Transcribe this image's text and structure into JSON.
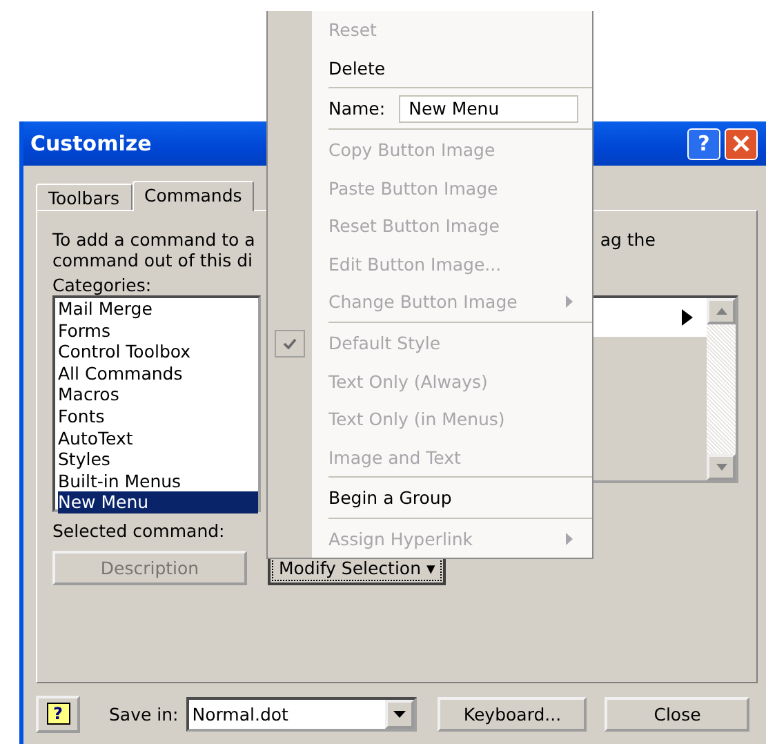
{
  "window": {
    "title": "Customize",
    "help_label": "?"
  },
  "tabs": [
    {
      "label": "Toolbars",
      "selected": false
    },
    {
      "label": "Commands",
      "selected": true
    }
  ],
  "instructions": {
    "line_1": "To add a command to a",
    "line_2": "command out of this di",
    "line_1_end": "ag the"
  },
  "categories": {
    "label": "Categories:",
    "items": [
      {
        "label": "Mail Merge",
        "selected": false
      },
      {
        "label": "Forms",
        "selected": false
      },
      {
        "label": "Control Toolbox",
        "selected": false
      },
      {
        "label": "All Commands",
        "selected": false
      },
      {
        "label": "Macros",
        "selected": false
      },
      {
        "label": "Fonts",
        "selected": false
      },
      {
        "label": "AutoText",
        "selected": false
      },
      {
        "label": "Styles",
        "selected": false
      },
      {
        "label": "Built-in Menus",
        "selected": false
      },
      {
        "label": "New Menu",
        "selected": true
      }
    ]
  },
  "commands": {
    "rows": [
      {
        "submenu": true,
        "selected": false
      }
    ]
  },
  "selected_command": {
    "label": "Selected command:",
    "description_button": {
      "label": "Description",
      "disabled": true
    },
    "modify_button": {
      "label": "Modify Selection",
      "caret": "▾"
    }
  },
  "menu": [
    {
      "kind": "command",
      "label": "Reset",
      "disabled": true,
      "checked": false,
      "submenu": false
    },
    {
      "kind": "command",
      "label": "Delete",
      "disabled": false,
      "checked": false,
      "submenu": false
    },
    {
      "kind": "separator"
    },
    {
      "kind": "field",
      "label": "Name:",
      "value": "New Menu"
    },
    {
      "kind": "separator"
    },
    {
      "kind": "command",
      "label": "Copy Button Image",
      "disabled": true,
      "checked": false,
      "submenu": false
    },
    {
      "kind": "command",
      "label": "Paste Button Image",
      "disabled": true,
      "checked": false,
      "submenu": false
    },
    {
      "kind": "command",
      "label": "Reset Button Image",
      "disabled": true,
      "checked": false,
      "submenu": false
    },
    {
      "kind": "command",
      "label": "Edit Button Image...",
      "disabled": true,
      "checked": false,
      "submenu": false
    },
    {
      "kind": "command",
      "label": "Change Button Image",
      "disabled": true,
      "checked": false,
      "submenu": true
    },
    {
      "kind": "separator"
    },
    {
      "kind": "command",
      "label": "Default Style",
      "disabled": true,
      "checked": true,
      "submenu": false
    },
    {
      "kind": "command",
      "label": "Text Only (Always)",
      "disabled": true,
      "checked": false,
      "submenu": false
    },
    {
      "kind": "command",
      "label": "Text Only (in Menus)",
      "disabled": true,
      "checked": false,
      "submenu": false
    },
    {
      "kind": "command",
      "label": "Image and Text",
      "disabled": true,
      "checked": false,
      "submenu": false
    },
    {
      "kind": "separator"
    },
    {
      "kind": "command",
      "label": "Begin a Group",
      "disabled": false,
      "checked": false,
      "submenu": false
    },
    {
      "kind": "separator"
    },
    {
      "kind": "command",
      "label": "Assign Hyperlink",
      "disabled": true,
      "checked": false,
      "submenu": true
    }
  ],
  "footer": {
    "help_label": "?",
    "save_in_label": "Save in:",
    "save_in_value": "Normal.dot",
    "keyboard_button": "Keyboard...",
    "close_button": "Close"
  }
}
